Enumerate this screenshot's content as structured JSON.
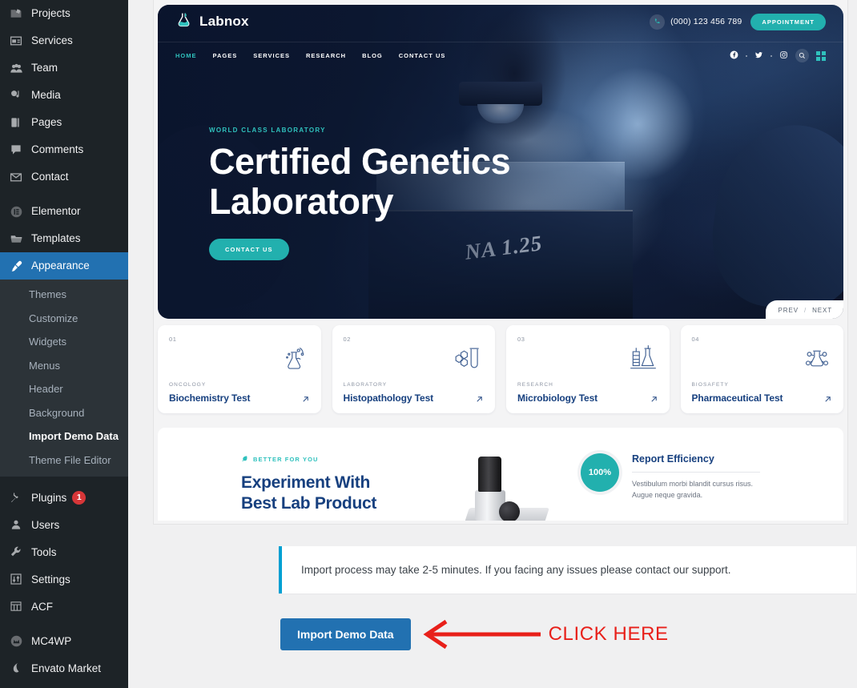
{
  "sidebar": {
    "items": [
      {
        "label": "Projects",
        "icon": "projects-icon"
      },
      {
        "label": "Services",
        "icon": "services-icon"
      },
      {
        "label": "Team",
        "icon": "team-icon"
      },
      {
        "label": "Media",
        "icon": "media-icon"
      },
      {
        "label": "Pages",
        "icon": "pages-icon"
      },
      {
        "label": "Comments",
        "icon": "comments-icon"
      },
      {
        "label": "Contact",
        "icon": "contact-icon"
      }
    ],
    "items2": [
      {
        "label": "Elementor",
        "icon": "elementor-icon"
      },
      {
        "label": "Templates",
        "icon": "templates-icon"
      }
    ],
    "appearance": {
      "label": "Appearance",
      "icon": "appearance-brush-icon"
    },
    "submenu": [
      {
        "label": "Themes",
        "active": false
      },
      {
        "label": "Customize",
        "active": false
      },
      {
        "label": "Widgets",
        "active": false
      },
      {
        "label": "Menus",
        "active": false
      },
      {
        "label": "Header",
        "active": false
      },
      {
        "label": "Background",
        "active": false
      },
      {
        "label": "Import Demo Data",
        "active": true
      },
      {
        "label": "Theme File Editor",
        "active": false
      }
    ],
    "items3": [
      {
        "label": "Plugins",
        "icon": "plugins-icon",
        "badge": "1"
      },
      {
        "label": "Users",
        "icon": "users-icon"
      },
      {
        "label": "Tools",
        "icon": "tools-wrench-icon"
      },
      {
        "label": "Settings",
        "icon": "settings-sliders-icon"
      },
      {
        "label": "ACF",
        "icon": "acf-grid-icon"
      }
    ],
    "items4": [
      {
        "label": "MC4WP",
        "icon": "mc4wp-icon"
      },
      {
        "label": "Envato Market",
        "icon": "envato-leaf-icon"
      }
    ]
  },
  "preview": {
    "brand": "Labnox",
    "phone": "(000) 123 456 789",
    "appointment_label": "APPOINTMENT",
    "nav": [
      "HOME",
      "PAGES",
      "SERVICES",
      "RESEARCH",
      "BLOG",
      "CONTACT US"
    ],
    "nav_active": "HOME",
    "hero": {
      "eyebrow": "WORLD CLASS LABORATORY",
      "title_line1": "Certified Genetics",
      "title_line2": "Laboratory",
      "cta_label": "CONTACT US",
      "image_text": "NA 1.25",
      "pager_prev": "PREV",
      "pager_sep": "/",
      "pager_next": "NEXT"
    },
    "cards": [
      {
        "num": "01",
        "category": "ONCOLOGY",
        "title": "Biochemistry Test",
        "icon": "flask-dna-icon"
      },
      {
        "num": "02",
        "category": "LABORATORY",
        "title": "Histopathology Test",
        "icon": "test-tube-molecule-icon"
      },
      {
        "num": "03",
        "category": "RESEARCH",
        "title": "Microbiology Test",
        "icon": "beaker-burette-icon"
      },
      {
        "num": "04",
        "category": "BIOSAFETY",
        "title": "Pharmaceutical Test",
        "icon": "molecule-flask-icon"
      }
    ],
    "experiment": {
      "eyebrow": "BETTER FOR YOU",
      "title_line1": "Experiment With",
      "title_line2": "Best Lab Product",
      "percent": "100%",
      "report_title": "Report Efficiency",
      "report_desc_line1": "Vestibulum morbi blandit cursus risus.",
      "report_desc_line2": "Augue neque gravida."
    }
  },
  "notice": {
    "text": "Import process may take 2-5 minutes. If you facing any issues please contact our support.",
    "accent_color": "#00a0d2"
  },
  "actions": {
    "import_button_label": "Import Demo Data",
    "annotation_text": "CLICK HERE",
    "annotation_color": "#e8201a",
    "button_color": "#2271b1"
  },
  "theme_colors": {
    "admin_sidebar": "#1d2327",
    "admin_submenu": "#2c3338",
    "admin_highlight": "#2271b1",
    "brand_teal": "#22b0ae",
    "brand_navy": "#17407f"
  }
}
